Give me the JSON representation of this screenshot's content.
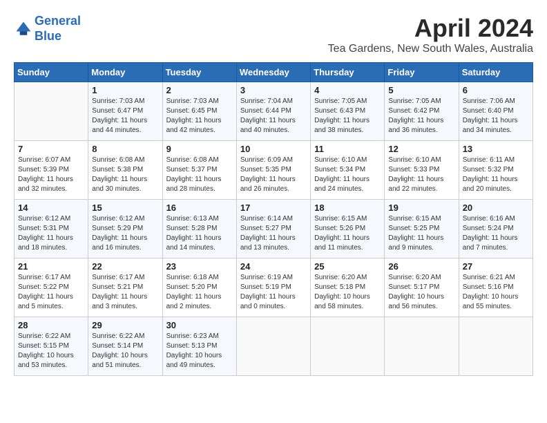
{
  "header": {
    "logo_line1": "General",
    "logo_line2": "Blue",
    "month": "April 2024",
    "location": "Tea Gardens, New South Wales, Australia"
  },
  "weekdays": [
    "Sunday",
    "Monday",
    "Tuesday",
    "Wednesday",
    "Thursday",
    "Friday",
    "Saturday"
  ],
  "weeks": [
    [
      {
        "day": "",
        "info": ""
      },
      {
        "day": "1",
        "info": "Sunrise: 7:03 AM\nSunset: 6:47 PM\nDaylight: 11 hours\nand 44 minutes."
      },
      {
        "day": "2",
        "info": "Sunrise: 7:03 AM\nSunset: 6:45 PM\nDaylight: 11 hours\nand 42 minutes."
      },
      {
        "day": "3",
        "info": "Sunrise: 7:04 AM\nSunset: 6:44 PM\nDaylight: 11 hours\nand 40 minutes."
      },
      {
        "day": "4",
        "info": "Sunrise: 7:05 AM\nSunset: 6:43 PM\nDaylight: 11 hours\nand 38 minutes."
      },
      {
        "day": "5",
        "info": "Sunrise: 7:05 AM\nSunset: 6:42 PM\nDaylight: 11 hours\nand 36 minutes."
      },
      {
        "day": "6",
        "info": "Sunrise: 7:06 AM\nSunset: 6:40 PM\nDaylight: 11 hours\nand 34 minutes."
      }
    ],
    [
      {
        "day": "7",
        "info": "Sunrise: 6:07 AM\nSunset: 5:39 PM\nDaylight: 11 hours\nand 32 minutes."
      },
      {
        "day": "8",
        "info": "Sunrise: 6:08 AM\nSunset: 5:38 PM\nDaylight: 11 hours\nand 30 minutes."
      },
      {
        "day": "9",
        "info": "Sunrise: 6:08 AM\nSunset: 5:37 PM\nDaylight: 11 hours\nand 28 minutes."
      },
      {
        "day": "10",
        "info": "Sunrise: 6:09 AM\nSunset: 5:35 PM\nDaylight: 11 hours\nand 26 minutes."
      },
      {
        "day": "11",
        "info": "Sunrise: 6:10 AM\nSunset: 5:34 PM\nDaylight: 11 hours\nand 24 minutes."
      },
      {
        "day": "12",
        "info": "Sunrise: 6:10 AM\nSunset: 5:33 PM\nDaylight: 11 hours\nand 22 minutes."
      },
      {
        "day": "13",
        "info": "Sunrise: 6:11 AM\nSunset: 5:32 PM\nDaylight: 11 hours\nand 20 minutes."
      }
    ],
    [
      {
        "day": "14",
        "info": "Sunrise: 6:12 AM\nSunset: 5:31 PM\nDaylight: 11 hours\nand 18 minutes."
      },
      {
        "day": "15",
        "info": "Sunrise: 6:12 AM\nSunset: 5:29 PM\nDaylight: 11 hours\nand 16 minutes."
      },
      {
        "day": "16",
        "info": "Sunrise: 6:13 AM\nSunset: 5:28 PM\nDaylight: 11 hours\nand 14 minutes."
      },
      {
        "day": "17",
        "info": "Sunrise: 6:14 AM\nSunset: 5:27 PM\nDaylight: 11 hours\nand 13 minutes."
      },
      {
        "day": "18",
        "info": "Sunrise: 6:15 AM\nSunset: 5:26 PM\nDaylight: 11 hours\nand 11 minutes."
      },
      {
        "day": "19",
        "info": "Sunrise: 6:15 AM\nSunset: 5:25 PM\nDaylight: 11 hours\nand 9 minutes."
      },
      {
        "day": "20",
        "info": "Sunrise: 6:16 AM\nSunset: 5:24 PM\nDaylight: 11 hours\nand 7 minutes."
      }
    ],
    [
      {
        "day": "21",
        "info": "Sunrise: 6:17 AM\nSunset: 5:22 PM\nDaylight: 11 hours\nand 5 minutes."
      },
      {
        "day": "22",
        "info": "Sunrise: 6:17 AM\nSunset: 5:21 PM\nDaylight: 11 hours\nand 3 minutes."
      },
      {
        "day": "23",
        "info": "Sunrise: 6:18 AM\nSunset: 5:20 PM\nDaylight: 11 hours\nand 2 minutes."
      },
      {
        "day": "24",
        "info": "Sunrise: 6:19 AM\nSunset: 5:19 PM\nDaylight: 11 hours\nand 0 minutes."
      },
      {
        "day": "25",
        "info": "Sunrise: 6:20 AM\nSunset: 5:18 PM\nDaylight: 10 hours\nand 58 minutes."
      },
      {
        "day": "26",
        "info": "Sunrise: 6:20 AM\nSunset: 5:17 PM\nDaylight: 10 hours\nand 56 minutes."
      },
      {
        "day": "27",
        "info": "Sunrise: 6:21 AM\nSunset: 5:16 PM\nDaylight: 10 hours\nand 55 minutes."
      }
    ],
    [
      {
        "day": "28",
        "info": "Sunrise: 6:22 AM\nSunset: 5:15 PM\nDaylight: 10 hours\nand 53 minutes."
      },
      {
        "day": "29",
        "info": "Sunrise: 6:22 AM\nSunset: 5:14 PM\nDaylight: 10 hours\nand 51 minutes."
      },
      {
        "day": "30",
        "info": "Sunrise: 6:23 AM\nSunset: 5:13 PM\nDaylight: 10 hours\nand 49 minutes."
      },
      {
        "day": "",
        "info": ""
      },
      {
        "day": "",
        "info": ""
      },
      {
        "day": "",
        "info": ""
      },
      {
        "day": "",
        "info": ""
      }
    ]
  ]
}
